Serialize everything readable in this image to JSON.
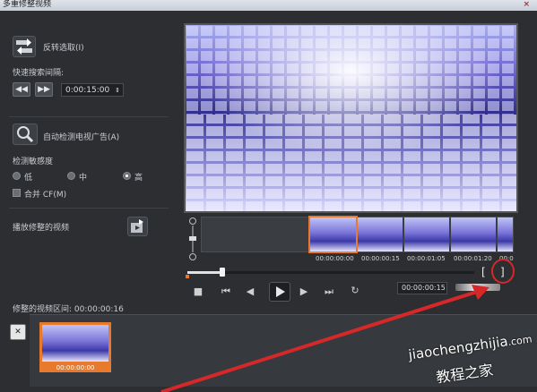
{
  "window": {
    "title": "多重修整视频",
    "close": "×"
  },
  "left_panel": {
    "invert_selection_label": "反转选取(I)",
    "quick_search_label": "快速搜索间隔:",
    "rewind_btn": "◀◀",
    "forward_btn": "▶▶",
    "interval_value": "0:00:15:00",
    "auto_detect_label": "自动检测电视广告(A)",
    "sensitivity_label": "检测敏感度",
    "sensitivity_options": [
      "低",
      "中",
      "高"
    ],
    "merge_cf_label": "合并 CF(M)",
    "play_trimmed_label": "播放修整的视频",
    "trimmed_duration_label": "修整的视频区间: 00:00:00:16"
  },
  "timeline": {
    "timecodes": [
      "00:00:00:00",
      "00:00:00:15",
      "00:00:01:05",
      "00:00:01:20",
      "00:0"
    ],
    "bracket_in": "[",
    "bracket_out": "]",
    "time_value": "00:00:00:15",
    "playhead_fraction": 0.12
  },
  "bottom": {
    "clip_timecode": "00:00:00:00",
    "remove_btn": "✕"
  },
  "watermark": {
    "url": "jiaochengzhijia",
    "domain": ".com",
    "brand": "教程之家"
  },
  "colors": {
    "accent_orange": "#e87a2d",
    "marker_red": "#d62828"
  }
}
